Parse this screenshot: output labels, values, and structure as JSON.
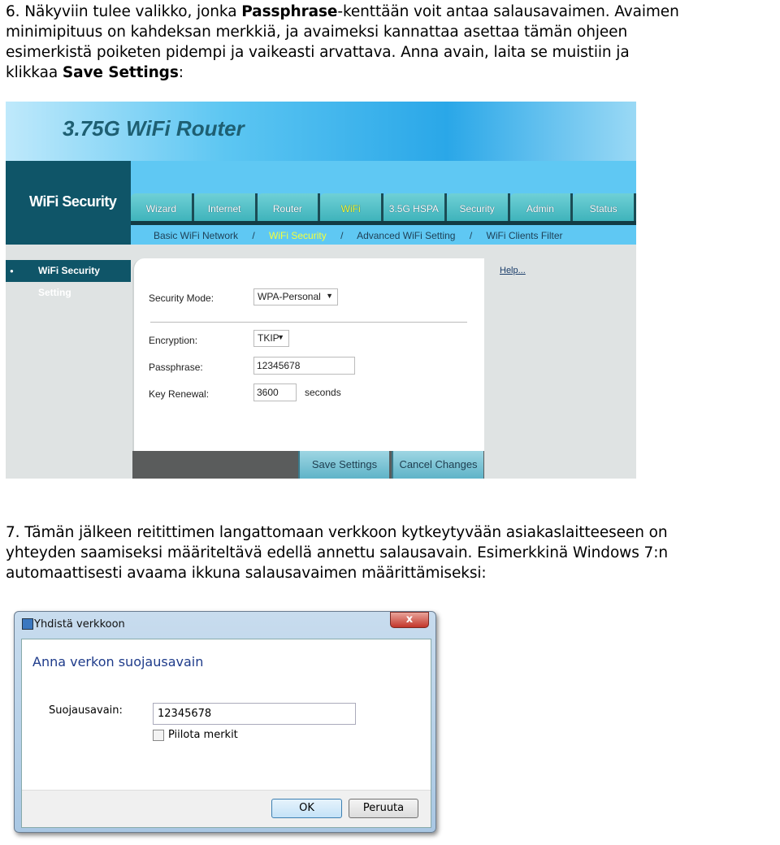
{
  "step6": {
    "lines": [
      [
        "6. Näkyviin tulee valikko, jonka ",
        "Passphrase",
        "-kenttään voit antaa salausavaimen. Avaimen"
      ],
      [
        "minimipituus on kahdeksan merkkiä, ja avaimeksi kannattaa asettaa tämän ohjeen"
      ],
      [
        "esimerkistä poiketen pidempi ja vaikeasti arvattava. Anna avain, laita se muistiin ja"
      ],
      [
        "klikkaa ",
        "Save Settings",
        ":"
      ]
    ]
  },
  "router": {
    "title": "3.75G WiFi Router",
    "section": "WiFi Security",
    "tabs": [
      "Wizard",
      "Internet",
      "Router",
      "WiFi",
      "3.5G HSPA",
      "Security",
      "Admin",
      "Status"
    ],
    "active_tab": "WiFi",
    "subnav": [
      "Basic WiFi Network",
      "/",
      "WiFi Security",
      "/",
      "Advanced WiFi Setting",
      "/",
      "WiFi Clients Filter"
    ],
    "sidebar_item": "WiFi Security Setting",
    "help": "Help...",
    "form": {
      "security_mode_label": "Security Mode:",
      "security_mode_value": "WPA-Personal",
      "encryption_label": "Encryption:",
      "encryption_value": "TKIP",
      "passphrase_label": "Passphrase:",
      "passphrase_value": "12345678",
      "key_renewal_label": "Key Renewal:",
      "key_renewal_value": "3600",
      "key_renewal_unit": "seconds"
    },
    "save_button": "Save Settings",
    "cancel_button": "Cancel Changes",
    "colors": {
      "accent_dark": "#0f5568",
      "nav": "#5fc8f3",
      "active": "#f4ff3a"
    }
  },
  "step7": {
    "lines": [
      "7. Tämän jälkeen reitittimen langattomaan verkkoon kytkeytyvään asiakaslaitteeseen on",
      "yhteyden saamiseksi määriteltävä edellä annettu salausavain. Esimerkkinä Windows 7:n",
      "automaattisesti avaama ikkuna salausavaimen määrittämiseksi:"
    ]
  },
  "dialog": {
    "title": "Yhdistä verkkoon",
    "close": "x",
    "heading": "Anna verkon suojausavain",
    "key_label": "Suojausavain:",
    "key_value": "12345678",
    "hide_label": "Piilota merkit",
    "hide_checked": false,
    "ok": "OK",
    "cancel": "Peruuta"
  }
}
